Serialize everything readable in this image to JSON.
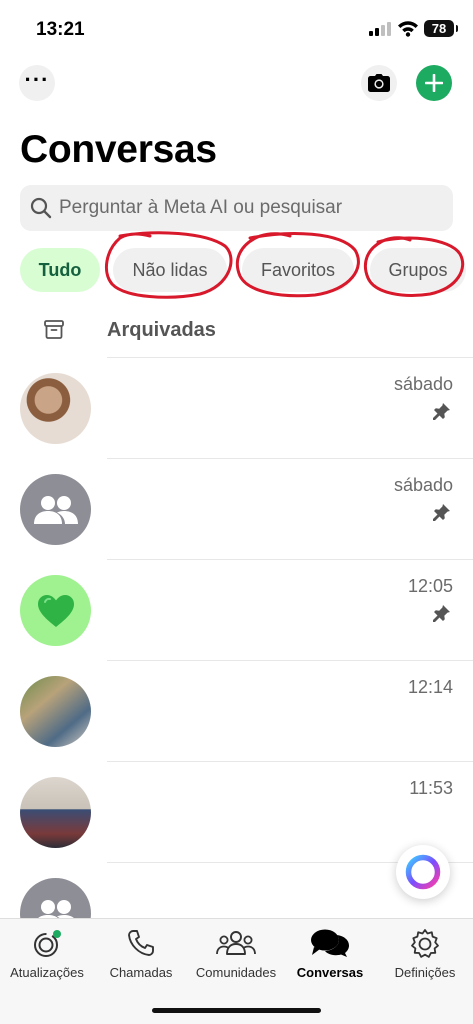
{
  "status_bar": {
    "time": "13:21",
    "battery": "78"
  },
  "header": {
    "title": "Conversas"
  },
  "search": {
    "placeholder": "Perguntar à Meta AI ou pesquisar"
  },
  "filters": [
    {
      "label": "Tudo",
      "active": true
    },
    {
      "label": "Não lidas",
      "active": false,
      "circled": true
    },
    {
      "label": "Favoritos",
      "active": false,
      "circled": true
    },
    {
      "label": "Grupos",
      "active": false,
      "circled": true
    }
  ],
  "archived": {
    "label": "Arquivadas"
  },
  "chats": [
    {
      "time": "sábado",
      "pinned": true
    },
    {
      "time": "sábado",
      "pinned": true
    },
    {
      "time": "12:05",
      "pinned": true
    },
    {
      "time": "12:14",
      "pinned": false
    },
    {
      "time": "11:53",
      "pinned": false
    },
    {
      "time": "",
      "pinned": false
    }
  ],
  "tabs": [
    {
      "label": "Atualizações",
      "icon": "status-icon"
    },
    {
      "label": "Chamadas",
      "icon": "phone-icon"
    },
    {
      "label": "Comunidades",
      "icon": "communities-icon"
    },
    {
      "label": "Conversas",
      "icon": "chats-icon",
      "active": true
    },
    {
      "label": "Definições",
      "icon": "settings-icon"
    }
  ],
  "colors": {
    "accent_green": "#1daa61",
    "active_chip_bg": "#d8fdd2",
    "active_chip_text": "#15603e",
    "annotation_red": "#d8182b"
  }
}
